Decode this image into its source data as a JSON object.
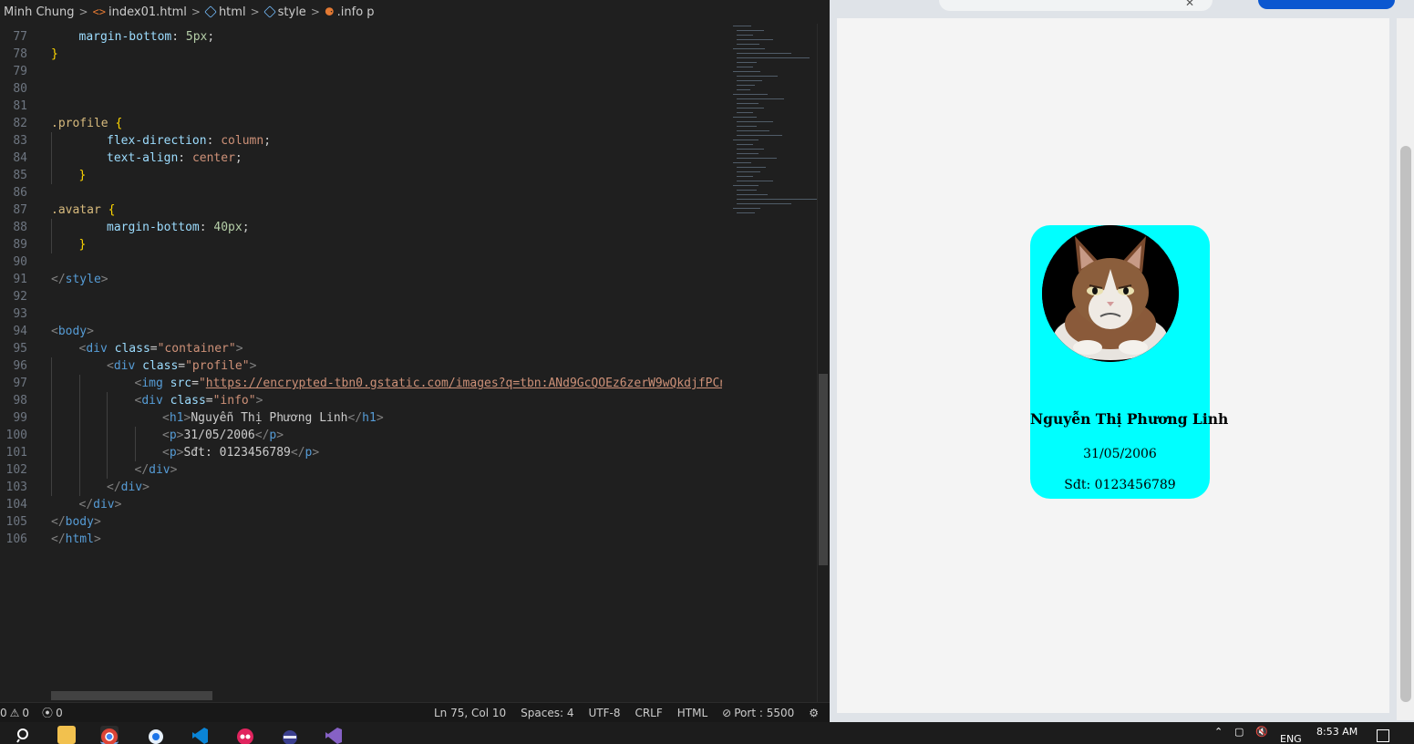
{
  "breadcrumb": {
    "folder": "Minh Chung",
    "file": "index01.html",
    "node1": "html",
    "node2": "style",
    "selector": ".info p"
  },
  "code_lines": [
    {
      "n": "77",
      "indent": 1,
      "tokens": [
        {
          "c": "t-prop",
          "t": "margin-bottom"
        },
        {
          "c": "t-txt",
          "t": ": "
        },
        {
          "c": "t-num",
          "t": "5px"
        },
        {
          "c": "t-txt",
          "t": ";"
        }
      ]
    },
    {
      "n": "78",
      "indent": 0,
      "tokens": [
        {
          "c": "t-brace",
          "t": "}"
        }
      ]
    },
    {
      "n": "79",
      "indent": 0,
      "tokens": []
    },
    {
      "n": "80",
      "indent": 0,
      "tokens": []
    },
    {
      "n": "81",
      "indent": 0,
      "tokens": []
    },
    {
      "n": "82",
      "indent": 0,
      "tokens": [
        {
          "c": "t-sel",
          "t": ".profile"
        },
        {
          "c": "t-txt",
          "t": " "
        },
        {
          "c": "t-brace",
          "t": "{"
        }
      ]
    },
    {
      "n": "83",
      "indent": 2,
      "tokens": [
        {
          "c": "t-prop",
          "t": "flex-direction"
        },
        {
          "c": "t-txt",
          "t": ": "
        },
        {
          "c": "t-val",
          "t": "column"
        },
        {
          "c": "t-txt",
          "t": ";"
        }
      ]
    },
    {
      "n": "84",
      "indent": 2,
      "tokens": [
        {
          "c": "t-prop",
          "t": "text-align"
        },
        {
          "c": "t-txt",
          "t": ": "
        },
        {
          "c": "t-val",
          "t": "center"
        },
        {
          "c": "t-txt",
          "t": ";"
        }
      ]
    },
    {
      "n": "85",
      "indent": 1,
      "tokens": [
        {
          "c": "t-brace",
          "t": "}"
        }
      ]
    },
    {
      "n": "86",
      "indent": 0,
      "tokens": []
    },
    {
      "n": "87",
      "indent": 0,
      "tokens": [
        {
          "c": "t-sel",
          "t": ".avatar"
        },
        {
          "c": "t-txt",
          "t": " "
        },
        {
          "c": "t-brace",
          "t": "{"
        }
      ]
    },
    {
      "n": "88",
      "indent": 2,
      "tokens": [
        {
          "c": "t-prop",
          "t": "margin-bottom"
        },
        {
          "c": "t-txt",
          "t": ": "
        },
        {
          "c": "t-num",
          "t": "40px"
        },
        {
          "c": "t-txt",
          "t": ";"
        }
      ]
    },
    {
      "n": "89",
      "indent": 1,
      "tokens": [
        {
          "c": "t-brace",
          "t": "}"
        }
      ]
    },
    {
      "n": "90",
      "indent": 0,
      "tokens": []
    },
    {
      "n": "91",
      "indent": 0,
      "tokens": [
        {
          "c": "t-punc",
          "t": "</"
        },
        {
          "c": "t-tag",
          "t": "style"
        },
        {
          "c": "t-punc",
          "t": ">"
        }
      ]
    },
    {
      "n": "92",
      "indent": 0,
      "tokens": []
    },
    {
      "n": "93",
      "indent": 0,
      "tokens": []
    },
    {
      "n": "94",
      "indent": 0,
      "tokens": [
        {
          "c": "t-punc",
          "t": "<"
        },
        {
          "c": "t-tag",
          "t": "body"
        },
        {
          "c": "t-punc",
          "t": ">"
        }
      ]
    },
    {
      "n": "95",
      "indent": 1,
      "tokens": [
        {
          "c": "t-punc",
          "t": "<"
        },
        {
          "c": "t-tag",
          "t": "div"
        },
        {
          "c": "t-txt",
          "t": " "
        },
        {
          "c": "t-attr",
          "t": "class"
        },
        {
          "c": "t-txt",
          "t": "="
        },
        {
          "c": "t-str",
          "t": "\"container\""
        },
        {
          "c": "t-punc",
          "t": ">"
        }
      ]
    },
    {
      "n": "96",
      "indent": 2,
      "tokens": [
        {
          "c": "t-punc",
          "t": "<"
        },
        {
          "c": "t-tag",
          "t": "div"
        },
        {
          "c": "t-txt",
          "t": " "
        },
        {
          "c": "t-attr",
          "t": "class"
        },
        {
          "c": "t-txt",
          "t": "="
        },
        {
          "c": "t-str",
          "t": "\"profile\""
        },
        {
          "c": "t-punc",
          "t": ">"
        }
      ]
    },
    {
      "n": "97",
      "indent": 3,
      "tokens": [
        {
          "c": "t-punc",
          "t": "<"
        },
        {
          "c": "t-tag",
          "t": "img"
        },
        {
          "c": "t-txt",
          "t": " "
        },
        {
          "c": "t-attr",
          "t": "src"
        },
        {
          "c": "t-txt",
          "t": "="
        },
        {
          "c": "t-str",
          "t": "\""
        },
        {
          "c": "t-url",
          "t": "https://encrypted-tbn0.gstatic.com/images?q=tbn:ANd9GcQOEz6zerW9wQkdjfPCnT"
        }
      ]
    },
    {
      "n": "98",
      "indent": 3,
      "tokens": [
        {
          "c": "t-punc",
          "t": "<"
        },
        {
          "c": "t-tag",
          "t": "div"
        },
        {
          "c": "t-txt",
          "t": " "
        },
        {
          "c": "t-attr",
          "t": "class"
        },
        {
          "c": "t-txt",
          "t": "="
        },
        {
          "c": "t-str",
          "t": "\"info\""
        },
        {
          "c": "t-punc",
          "t": ">"
        }
      ]
    },
    {
      "n": "99",
      "indent": 4,
      "tokens": [
        {
          "c": "t-punc",
          "t": "<"
        },
        {
          "c": "t-tag",
          "t": "h1"
        },
        {
          "c": "t-punc",
          "t": ">"
        },
        {
          "c": "t-txt",
          "t": "Nguyễn Thị Phương Linh"
        },
        {
          "c": "t-punc",
          "t": "</"
        },
        {
          "c": "t-tag",
          "t": "h1"
        },
        {
          "c": "t-punc",
          "t": ">"
        }
      ]
    },
    {
      "n": "100",
      "indent": 4,
      "tokens": [
        {
          "c": "t-punc",
          "t": "<"
        },
        {
          "c": "t-tag",
          "t": "p"
        },
        {
          "c": "t-punc",
          "t": ">"
        },
        {
          "c": "t-txt",
          "t": "31/05/2006"
        },
        {
          "c": "t-punc",
          "t": "</"
        },
        {
          "c": "t-tag",
          "t": "p"
        },
        {
          "c": "t-punc",
          "t": ">"
        }
      ]
    },
    {
      "n": "101",
      "indent": 4,
      "tokens": [
        {
          "c": "t-punc",
          "t": "<"
        },
        {
          "c": "t-tag",
          "t": "p"
        },
        {
          "c": "t-punc",
          "t": ">"
        },
        {
          "c": "t-txt",
          "t": "Sđt: 0123456789"
        },
        {
          "c": "t-punc",
          "t": "</"
        },
        {
          "c": "t-tag",
          "t": "p"
        },
        {
          "c": "t-punc",
          "t": ">"
        }
      ]
    },
    {
      "n": "102",
      "indent": 3,
      "tokens": [
        {
          "c": "t-punc",
          "t": "</"
        },
        {
          "c": "t-tag",
          "t": "div"
        },
        {
          "c": "t-punc",
          "t": ">"
        }
      ]
    },
    {
      "n": "103",
      "indent": 2,
      "tokens": [
        {
          "c": "t-punc",
          "t": "</"
        },
        {
          "c": "t-tag",
          "t": "div"
        },
        {
          "c": "t-punc",
          "t": ">"
        }
      ]
    },
    {
      "n": "104",
      "indent": 1,
      "tokens": [
        {
          "c": "t-punc",
          "t": "</"
        },
        {
          "c": "t-tag",
          "t": "div"
        },
        {
          "c": "t-punc",
          "t": ">"
        }
      ]
    },
    {
      "n": "105",
      "indent": 0,
      "tokens": [
        {
          "c": "t-punc",
          "t": "</"
        },
        {
          "c": "t-tag",
          "t": "body"
        },
        {
          "c": "t-punc",
          "t": ">"
        }
      ]
    },
    {
      "n": "106",
      "indent": 0,
      "tokens": [
        {
          "c": "t-punc",
          "t": "</"
        },
        {
          "c": "t-tag",
          "t": "html"
        },
        {
          "c": "t-punc",
          "t": ">"
        }
      ]
    }
  ],
  "status": {
    "errors": "0",
    "warnings": "0",
    "ports": "0",
    "position": "Ln 75, Col 10",
    "spaces": "Spaces: 4",
    "encoding": "UTF-8",
    "eol": "CRLF",
    "language": "HTML",
    "port": "Port : 5500"
  },
  "profile": {
    "name": "Nguyễn Thị Phương Linh",
    "dob": "31/05/2006",
    "phone": "Sđt: 0123456789",
    "avatar_subject": "cat-photo"
  },
  "taskbar": {
    "apps": [
      "search-icon",
      "file-explorer-icon",
      "chrome-icon",
      "app-icon",
      "vscode-icon",
      "app-icon",
      "app-icon",
      "visual-studio-icon"
    ],
    "lang": "ENG",
    "time": "8:53 AM"
  },
  "colors": {
    "card_bg": "#00ffff",
    "editor_bg": "#1f1f1f",
    "page_bg": "#f4f4f4"
  }
}
